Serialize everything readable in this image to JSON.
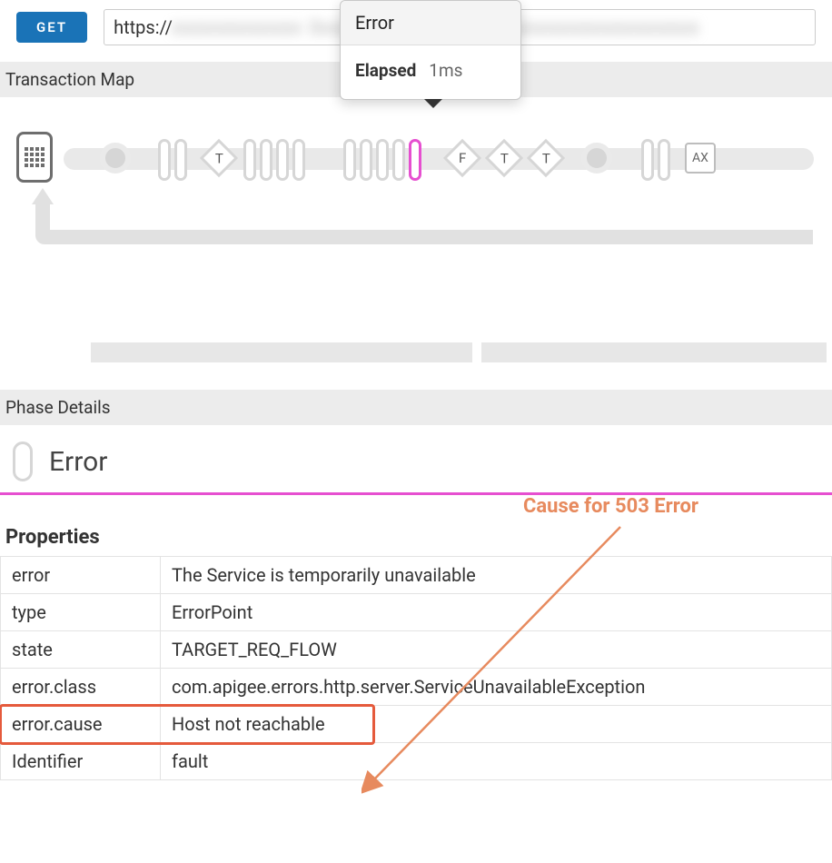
{
  "method": "GET",
  "url_prefix": "https://",
  "transaction_map_label": "Transaction Map",
  "tooltip": {
    "title": "Error",
    "elapsed_label": "Elapsed",
    "elapsed_value": "1ms"
  },
  "nodes": {
    "d1": "T",
    "d2": "F",
    "d3": "T",
    "d4": "T",
    "box": "AX"
  },
  "phase_details_label": "Phase Details",
  "phase_title": "Error",
  "annotation": "Cause for 503 Error",
  "properties_heading": "Properties",
  "props": [
    {
      "k": "error",
      "v": "The Service is temporarily unavailable"
    },
    {
      "k": "type",
      "v": "ErrorPoint"
    },
    {
      "k": "state",
      "v": "TARGET_REQ_FLOW"
    },
    {
      "k": "error.class",
      "v": "com.apigee.errors.http.server.ServiceUnavailableException"
    },
    {
      "k": "error.cause",
      "v": "Host not reachable"
    },
    {
      "k": "Identifier",
      "v": "fault"
    }
  ]
}
